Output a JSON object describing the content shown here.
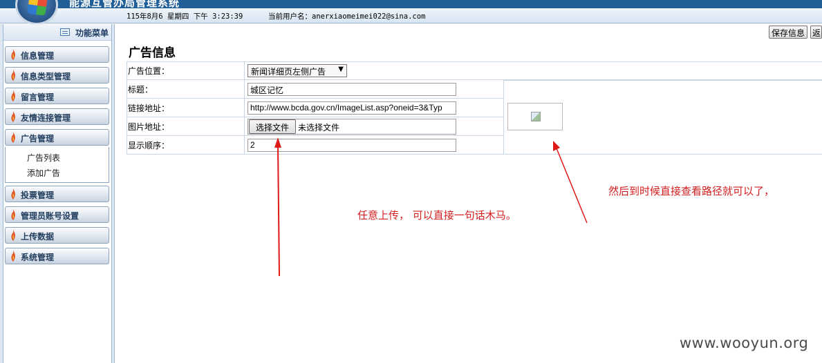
{
  "header": {
    "app_title": "能源互管办局管理系统",
    "date_time": "115年8月6 星期四 下午 3:23:39",
    "current_user_label": "当前用户名：",
    "current_user": "anerxiaomeimei022@sina.com"
  },
  "sidebar": {
    "heading": "功能菜单",
    "items": [
      {
        "label": "信息管理",
        "icon": "flame-icon"
      },
      {
        "label": "信息类型管理",
        "icon": "flame-icon"
      },
      {
        "label": "留言管理",
        "icon": "flame-icon"
      },
      {
        "label": "友情连接管理",
        "icon": "flame-icon"
      },
      {
        "label": "广告管理",
        "icon": "flame-icon",
        "expanded": true
      },
      {
        "label": "投票管理",
        "icon": "flame-icon"
      },
      {
        "label": "管理员账号设置",
        "icon": "flame-icon"
      },
      {
        "label": "上传数据",
        "icon": "flame-icon"
      },
      {
        "label": "系统管理",
        "icon": "flame-icon"
      }
    ],
    "submenu": [
      "广告列表",
      "添加广告"
    ]
  },
  "toolbar": {
    "save_label": "保存信息",
    "back_label": "返"
  },
  "form": {
    "title": "广告信息",
    "position_label": "广告位置：",
    "position_value": "新闻详细页左侧广告",
    "title_label": "标题：",
    "title_value": "城区记忆",
    "link_label": "链接地址：",
    "link_value": "http://www.bcda.gov.cn/ImageList.asp?oneid=3&Typ",
    "image_label": "图片地址：",
    "file_button_label": "选择文件",
    "file_status": "未选择文件",
    "order_label": "显示顺序：",
    "order_value": "2"
  },
  "annotations": {
    "upload_note": "任意上传，  可以直接一句话木马。",
    "path_note": "然后到时候直接查看路径就可以了，"
  },
  "watermark": "www.wooyun.org",
  "colors": {
    "header_blue": "#1f5e96",
    "annotation_red": "#d21e1e",
    "menu_text": "#233e5e"
  }
}
